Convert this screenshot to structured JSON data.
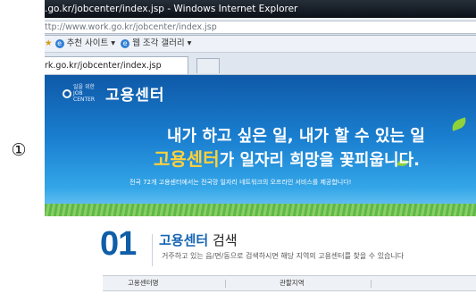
{
  "marker": "①",
  "browser": {
    "window_title": ".go.kr/jobcenter/index.jsp - Windows Internet Explorer",
    "address": "ttp://www.work.go.kr/jobcenter/index.jsp",
    "favorites": [
      "추천 사이트 ▾",
      "웹 조각 갤러리 ▾"
    ],
    "tab_title": "rk.go.kr/jobcenter/index.jsp"
  },
  "banner": {
    "logo_small": "일을 위한 JOB CENTER",
    "logo": "고용센터",
    "slogan_line1": "내가 하고 싶은 일, 내가 할 수 있는 일",
    "slogan_highlight": "고용센터",
    "slogan_particle": "가",
    "slogan_rest": " 일자리 희망을 꽃피웁니다.",
    "subline": "전국 72개 고용센터에서는 전국망 일자리 네트워크의 오프라인 서비스를 제공합니다!"
  },
  "section": {
    "number": "01",
    "title_highlight": "고용센터",
    "title_rest": " 검색",
    "description": "거주하고 있는 읍/면/동으로 검색하시면 해당 지역의 고용센터를 찾을 수 있습니다",
    "columns": [
      "고용센터명",
      "관할지역"
    ]
  },
  "colors": {
    "brand_blue": "#0f5ea8",
    "highlight_yellow": "#ffd23a"
  }
}
